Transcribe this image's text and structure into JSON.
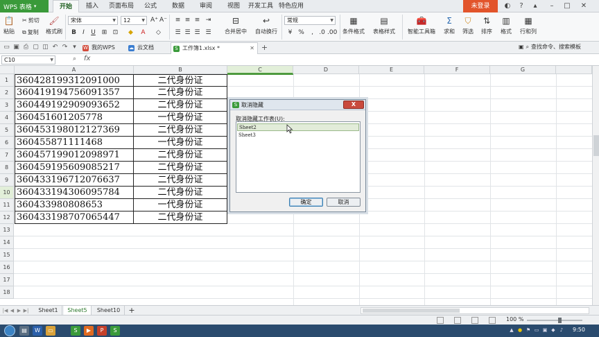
{
  "app": {
    "name": "WPS 表格",
    "login_button": "未登录"
  },
  "ribbon_tabs": [
    "开始",
    "插入",
    "页面布局",
    "公式",
    "数据",
    "审阅",
    "视图",
    "开发工具",
    "特色应用"
  ],
  "ribbon": {
    "paste": "粘贴",
    "cut": "剪切",
    "copy": "复制",
    "format_painter": "格式刷",
    "font_name": "宋体",
    "font_size": "12",
    "bold": "B",
    "italic": "I",
    "underline": "U",
    "merge_center": "合并居中",
    "auto_wrap": "自动换行",
    "number_format": "常规",
    "percent": "%",
    "conditional_format": "条件格式",
    "table_style": "表格样式",
    "smart_toolbox": "智能工具箱",
    "sum": "求和",
    "filter": "筛选",
    "sort": "排序",
    "format": "格式",
    "rows_cols": "行和列"
  },
  "doc_tabs": [
    {
      "label": "我的WPS",
      "active": false
    },
    {
      "label": "云文档",
      "active": false
    },
    {
      "label": "工作簿1.xlsx *",
      "active": true
    }
  ],
  "search_command": "查找命令、搜索模板",
  "formula_bar": {
    "name_box": "C10",
    "fx": "fx",
    "content": ""
  },
  "columns": [
    "A",
    "B",
    "C",
    "D",
    "E",
    "F",
    "G"
  ],
  "rows": [
    "1",
    "2",
    "3",
    "4",
    "5",
    "6",
    "7",
    "8",
    "9",
    "10",
    "11",
    "12",
    "13",
    "14",
    "15",
    "16",
    "17",
    "18"
  ],
  "selected_cell": {
    "col": "C",
    "row": "10"
  },
  "cells": [
    {
      "a": "360428199312091000",
      "b": "二代身份证"
    },
    {
      "a": "360419194756091357",
      "b": "二代身份证"
    },
    {
      "a": "360449192909093652",
      "b": "二代身份证"
    },
    {
      "a": "360451601205778",
      "b": "一代身份证"
    },
    {
      "a": "360453198012127369",
      "b": "二代身份证"
    },
    {
      "a": "360455871111468",
      "b": "一代身份证"
    },
    {
      "a": "360457199012098971",
      "b": "二代身份证"
    },
    {
      "a": "360459195609085217",
      "b": "二代身份证"
    },
    {
      "a": "360433196712076637",
      "b": "二代身份证"
    },
    {
      "a": "360433194306095784",
      "b": "二代身份证"
    },
    {
      "a": "360433980808653",
      "b": "一代身份证"
    },
    {
      "a": "360433198707065447",
      "b": "二代身份证"
    }
  ],
  "sheet_tabs": [
    {
      "label": "Sheet1",
      "active": false
    },
    {
      "label": "Sheet5",
      "active": true
    },
    {
      "label": "Sheet10",
      "active": false
    }
  ],
  "add_sheet": "+",
  "status": {
    "zoom": "100 %"
  },
  "taskbar": {
    "clock": "9:50"
  },
  "dialog": {
    "title": "取消隐藏",
    "close": "X",
    "list_label": "取消隐藏工作表(U):",
    "items": [
      {
        "label": "Sheet2",
        "selected": true
      },
      {
        "label": "Sheet3",
        "selected": false
      }
    ],
    "ok": "确定",
    "cancel": "取消"
  },
  "colors": {
    "brand_green": "#3a9a3a",
    "login_orange": "#e2542b",
    "close_red": "#c94a3d",
    "selection_green": "#4e9a3e"
  }
}
